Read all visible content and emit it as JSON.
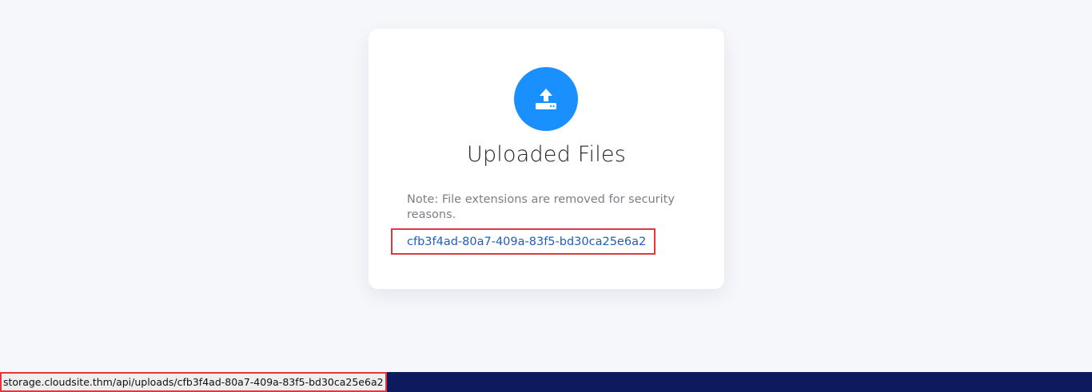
{
  "card": {
    "icon": "upload-icon",
    "title": "Uploaded Files",
    "note": "Note: File extensions are removed for security reasons.",
    "files": [
      "cfb3f4ad-80a7-409a-83f5-bd30ca25e6a2"
    ]
  },
  "status_bar": {
    "url": "storage.cloudsite.thm/api/uploads/cfb3f4ad-80a7-409a-83f5-bd30ca25e6a2"
  },
  "colors": {
    "accent": "#1a90ff",
    "link": "#1f5fb8",
    "highlight": "#e0383e",
    "status_bar": "#0e1a5e",
    "background": "#f6f7fb"
  }
}
